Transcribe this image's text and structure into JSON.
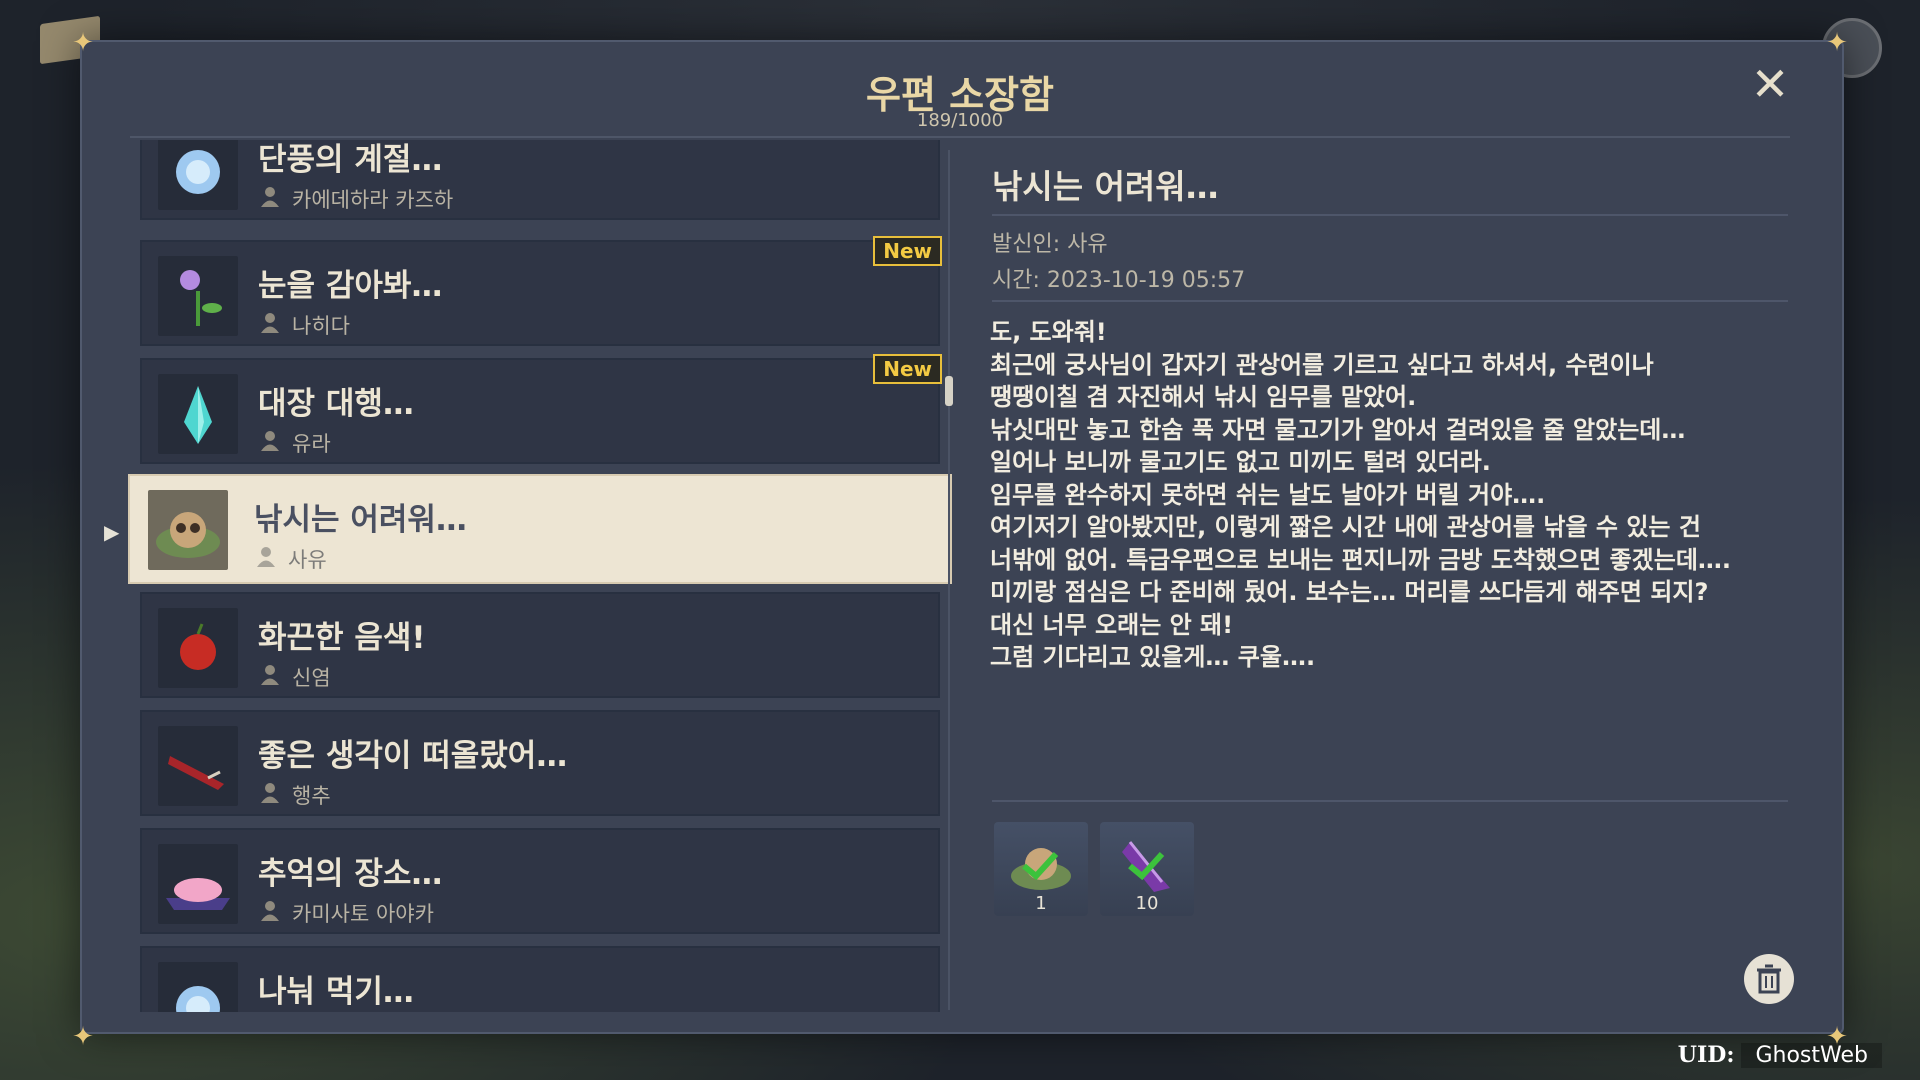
{
  "header": {
    "title": "우편 소장함",
    "count": "189/1000"
  },
  "mail_list": [
    {
      "title": "단풍의 계절…",
      "sender": "카에데하라 카즈하",
      "new": false,
      "icon": "blue-flower-icon"
    },
    {
      "title": "눈을 감아봐…",
      "sender": "나히다",
      "new": true,
      "icon": "purple-flower-icon"
    },
    {
      "title": "대장 대행…",
      "sender": "유라",
      "new": true,
      "icon": "ice-crystal-icon"
    },
    {
      "title": "낚시는 어려워…",
      "sender": "사유",
      "new": false,
      "selected": true,
      "icon": "tanuki-dish-icon"
    },
    {
      "title": "화끈한 음색!",
      "sender": "신염",
      "new": false,
      "icon": "red-fruit-icon"
    },
    {
      "title": "좋은 생각이 떠올랐어…",
      "sender": "행추",
      "new": false,
      "icon": "sword-icon"
    },
    {
      "title": "추억의 장소…",
      "sender": "카미사토 아야카",
      "new": false,
      "icon": "pink-dessert-icon"
    },
    {
      "title": "나눠 먹기…",
      "sender": "",
      "new": false,
      "icon": "blue-flower-icon"
    }
  ],
  "new_label": "New",
  "detail": {
    "title": "낚시는 어려워…",
    "sender": "발신인: 사유",
    "time": "시간: 2023-10-19 05:57",
    "body": [
      "도, 도와줘!",
      "최근에 궁사님이 갑자기 관상어를 기르고 싶다고 하셔서, 수련이나",
      "땡땡이칠 겸 자진해서 낚시 임무를 맡았어.",
      "낚싯대만 놓고 한숨 푹 자면 물고기가 알아서 걸려있을 줄 알았는데…",
      "일어나 보니까 물고기도 없고 미끼도 털려 있더라.",
      "임무를 완수하지 못하면 쉬는 날도 날아가 버릴 거야….",
      "여기저기 알아봤지만, 이렇게 짧은 시간 내에 관상어를 낚을 수 있는 건",
      "너밖에 없어. 특급우편으로 보내는 편지니까 금방 도착했으면 좋겠는데….",
      "미끼랑 점심은 다 준비해 뒀어. 보수는… 머리를 쓰다듬게 해주면 되지?",
      "대신 너무 오래는 안 돼!",
      "그럼 기다리고 있을게… 쿠울…."
    ],
    "attachments": [
      {
        "qty": "1",
        "icon": "tanuki-dish-icon",
        "claimed": true
      },
      {
        "qty": "10",
        "icon": "purple-feather-icon",
        "claimed": true
      }
    ]
  },
  "uid": {
    "label": "UID:",
    "value": "GhostWeb"
  },
  "colors": {
    "panel": "#3c4354",
    "accent_gold": "#e8bf3b",
    "selected_bg": "#ede5d3",
    "check_green": "#3cc23c"
  }
}
